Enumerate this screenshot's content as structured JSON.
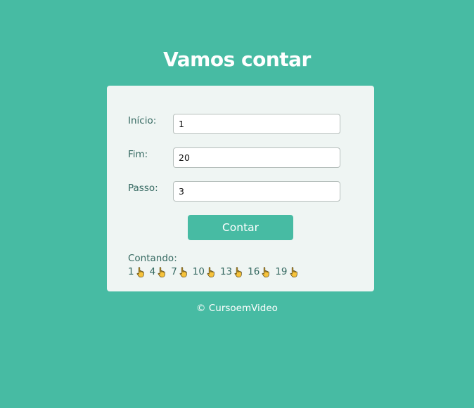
{
  "page": {
    "title": "Vamos contar",
    "footer": "© CursoemVideo"
  },
  "form": {
    "inicio": {
      "label": "Início:",
      "value": "1"
    },
    "fim": {
      "label": "Fim:",
      "value": "20"
    },
    "passo": {
      "label": "Passo:",
      "value": "3"
    },
    "button_label": "Contar"
  },
  "result": {
    "heading": "Contando:",
    "values": [
      "1",
      "4",
      "7",
      "10",
      "13",
      "16",
      "19"
    ],
    "marker_icon": "pointing-hand-icon"
  },
  "colors": {
    "background": "#47BBA3",
    "card": "#EFF5F3",
    "accent": "#47BBA3",
    "text": "#346860"
  }
}
